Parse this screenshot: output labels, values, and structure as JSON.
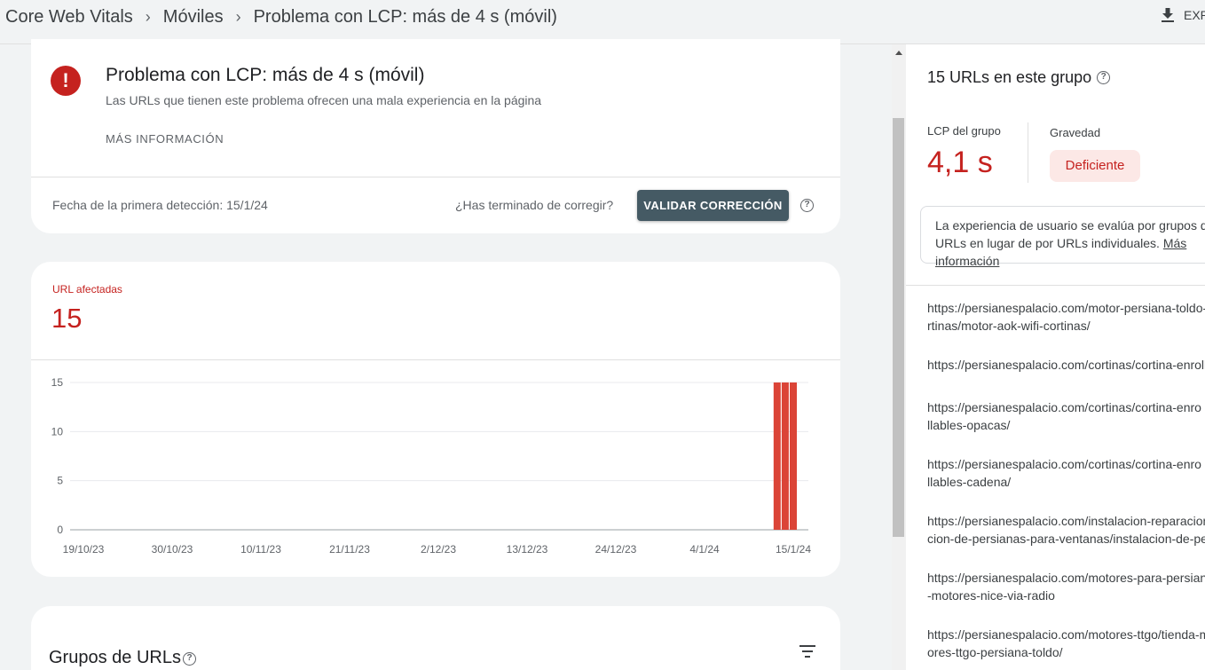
{
  "breadcrumb": {
    "items": [
      "Core Web Vitals",
      "Móviles",
      "Problema con LCP: más de 4 s (móvil)"
    ],
    "separator": "›"
  },
  "header": {
    "export_label": "EXPORTAR"
  },
  "issue": {
    "title": "Problema con LCP: más de 4 s (móvil)",
    "subtitle": "Las URLs que tienen este problema ofrecen una mala experiencia en la página",
    "more_info": "MÁS INFORMACIÓN",
    "first_detected": "Fecha de la primera detección: 15/1/24",
    "fixed_question": "¿Has terminado de corregir?",
    "validate_label": "VALIDAR CORRECCIÓN",
    "icon": "error-icon",
    "color": "#c5221f"
  },
  "affected": {
    "label": "URL afectadas",
    "value": "15"
  },
  "chart_data": {
    "type": "bar",
    "x_tick_labels": [
      "19/10/23",
      "30/10/23",
      "10/11/23",
      "21/11/23",
      "2/12/23",
      "13/12/23",
      "24/12/23",
      "4/1/24",
      "15/1/24"
    ],
    "y_ticks": [
      0,
      5,
      10,
      15
    ],
    "ylim": [
      0,
      15
    ],
    "bars": [
      {
        "x": "13/1/24",
        "value": 15
      },
      {
        "x": "14/1/24",
        "value": 15
      },
      {
        "x": "15/1/24",
        "value": 15
      }
    ],
    "bar_color": "#db4437"
  },
  "groups": {
    "title": "Grupos de URLs"
  },
  "panel": {
    "title": "15 URLs en este grupo",
    "lcp_label": "LCP del grupo",
    "lcp_value": "4,1 s",
    "severity_label": "Gravedad",
    "severity_value": "Deficiente",
    "note_text": "La experiencia de usuario se evalúa por grupos de URLs en lugar de por URLs",
    "note_text_2": "individuales.",
    "note_link": "Más información",
    "urls": [
      [
        "https://persianespalacio.com/motor-persiana-toldo-y-co",
        "rtinas/motor-aok-wifi-cortinas/"
      ],
      [
        "https://persianespalacio.com/cortinas/cortina-enrollable/"
      ],
      [
        "https://persianespalacio.com/cortinas/cortina-enro",
        "llables-opacas/"
      ],
      [
        "https://persianespalacio.com/cortinas/cortina-enro",
        "llables-cadena/"
      ],
      [
        "https://persianespalacio.com/instalacion-reparacion-",
        "cion-de-persianas-para-ventanas/instalacion-de-persianas/"
      ],
      [
        "https://persianespalacio.com/motores-para-persianas",
        "-motores-nice-via-radio"
      ],
      [
        "https://persianespalacio.com/motores-ttgo/tienda-mot",
        "ores-ttgo-persiana-toldo/"
      ]
    ]
  }
}
